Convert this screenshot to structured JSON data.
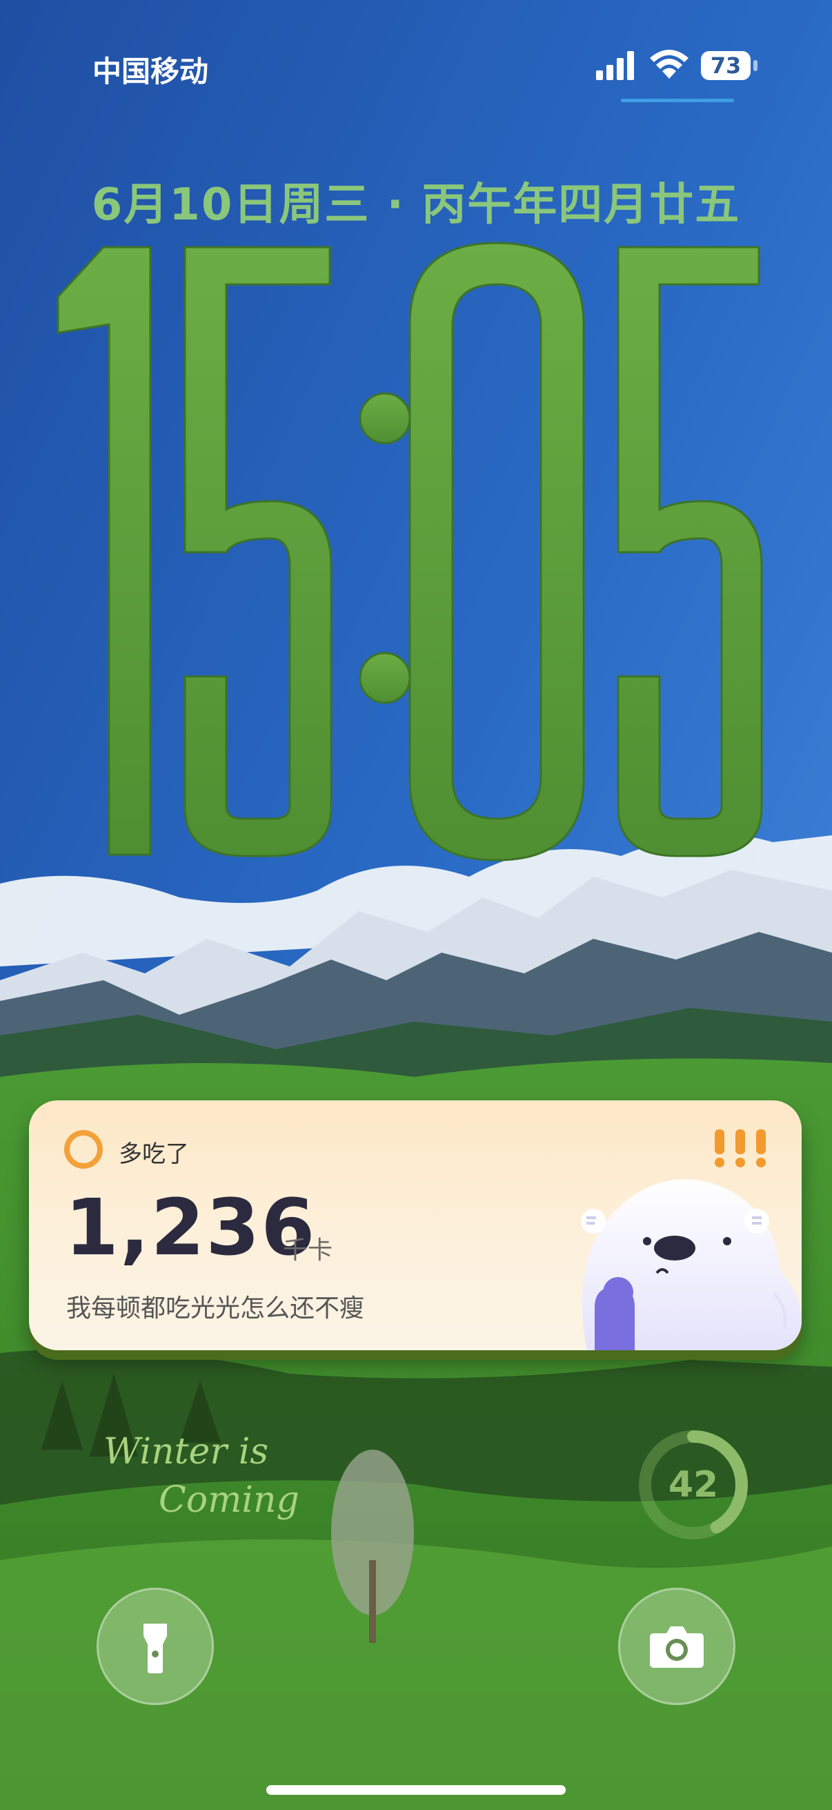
{
  "status_bar": {
    "carrier": "中国移动",
    "battery": "73",
    "signal_icon": "cellular-signal-icon",
    "wifi_icon": "wifi-icon"
  },
  "lock_screen": {
    "date": "6月10日周三 · 丙午年四月廿五",
    "time": "15:05"
  },
  "widget": {
    "label": "多吃了",
    "alert": "!!!",
    "calories": "1,236",
    "unit": "千卡",
    "subtitle": "我每顿都吃光光怎么还不瘦"
  },
  "workout_ring": {
    "value": "42",
    "progress": 0.42
  },
  "handwriting": {
    "line1": "Winter is",
    "line2": "Coming"
  },
  "buttons": {
    "flashlight_icon": "flashlight-icon",
    "camera_icon": "camera-icon"
  },
  "colors": {
    "clock": "#5f9e3d",
    "date": "#8bc77b",
    "widget_bg": "#fde8c7",
    "ring": "#8dbb6a",
    "accent_orange": "#f2a13a"
  }
}
